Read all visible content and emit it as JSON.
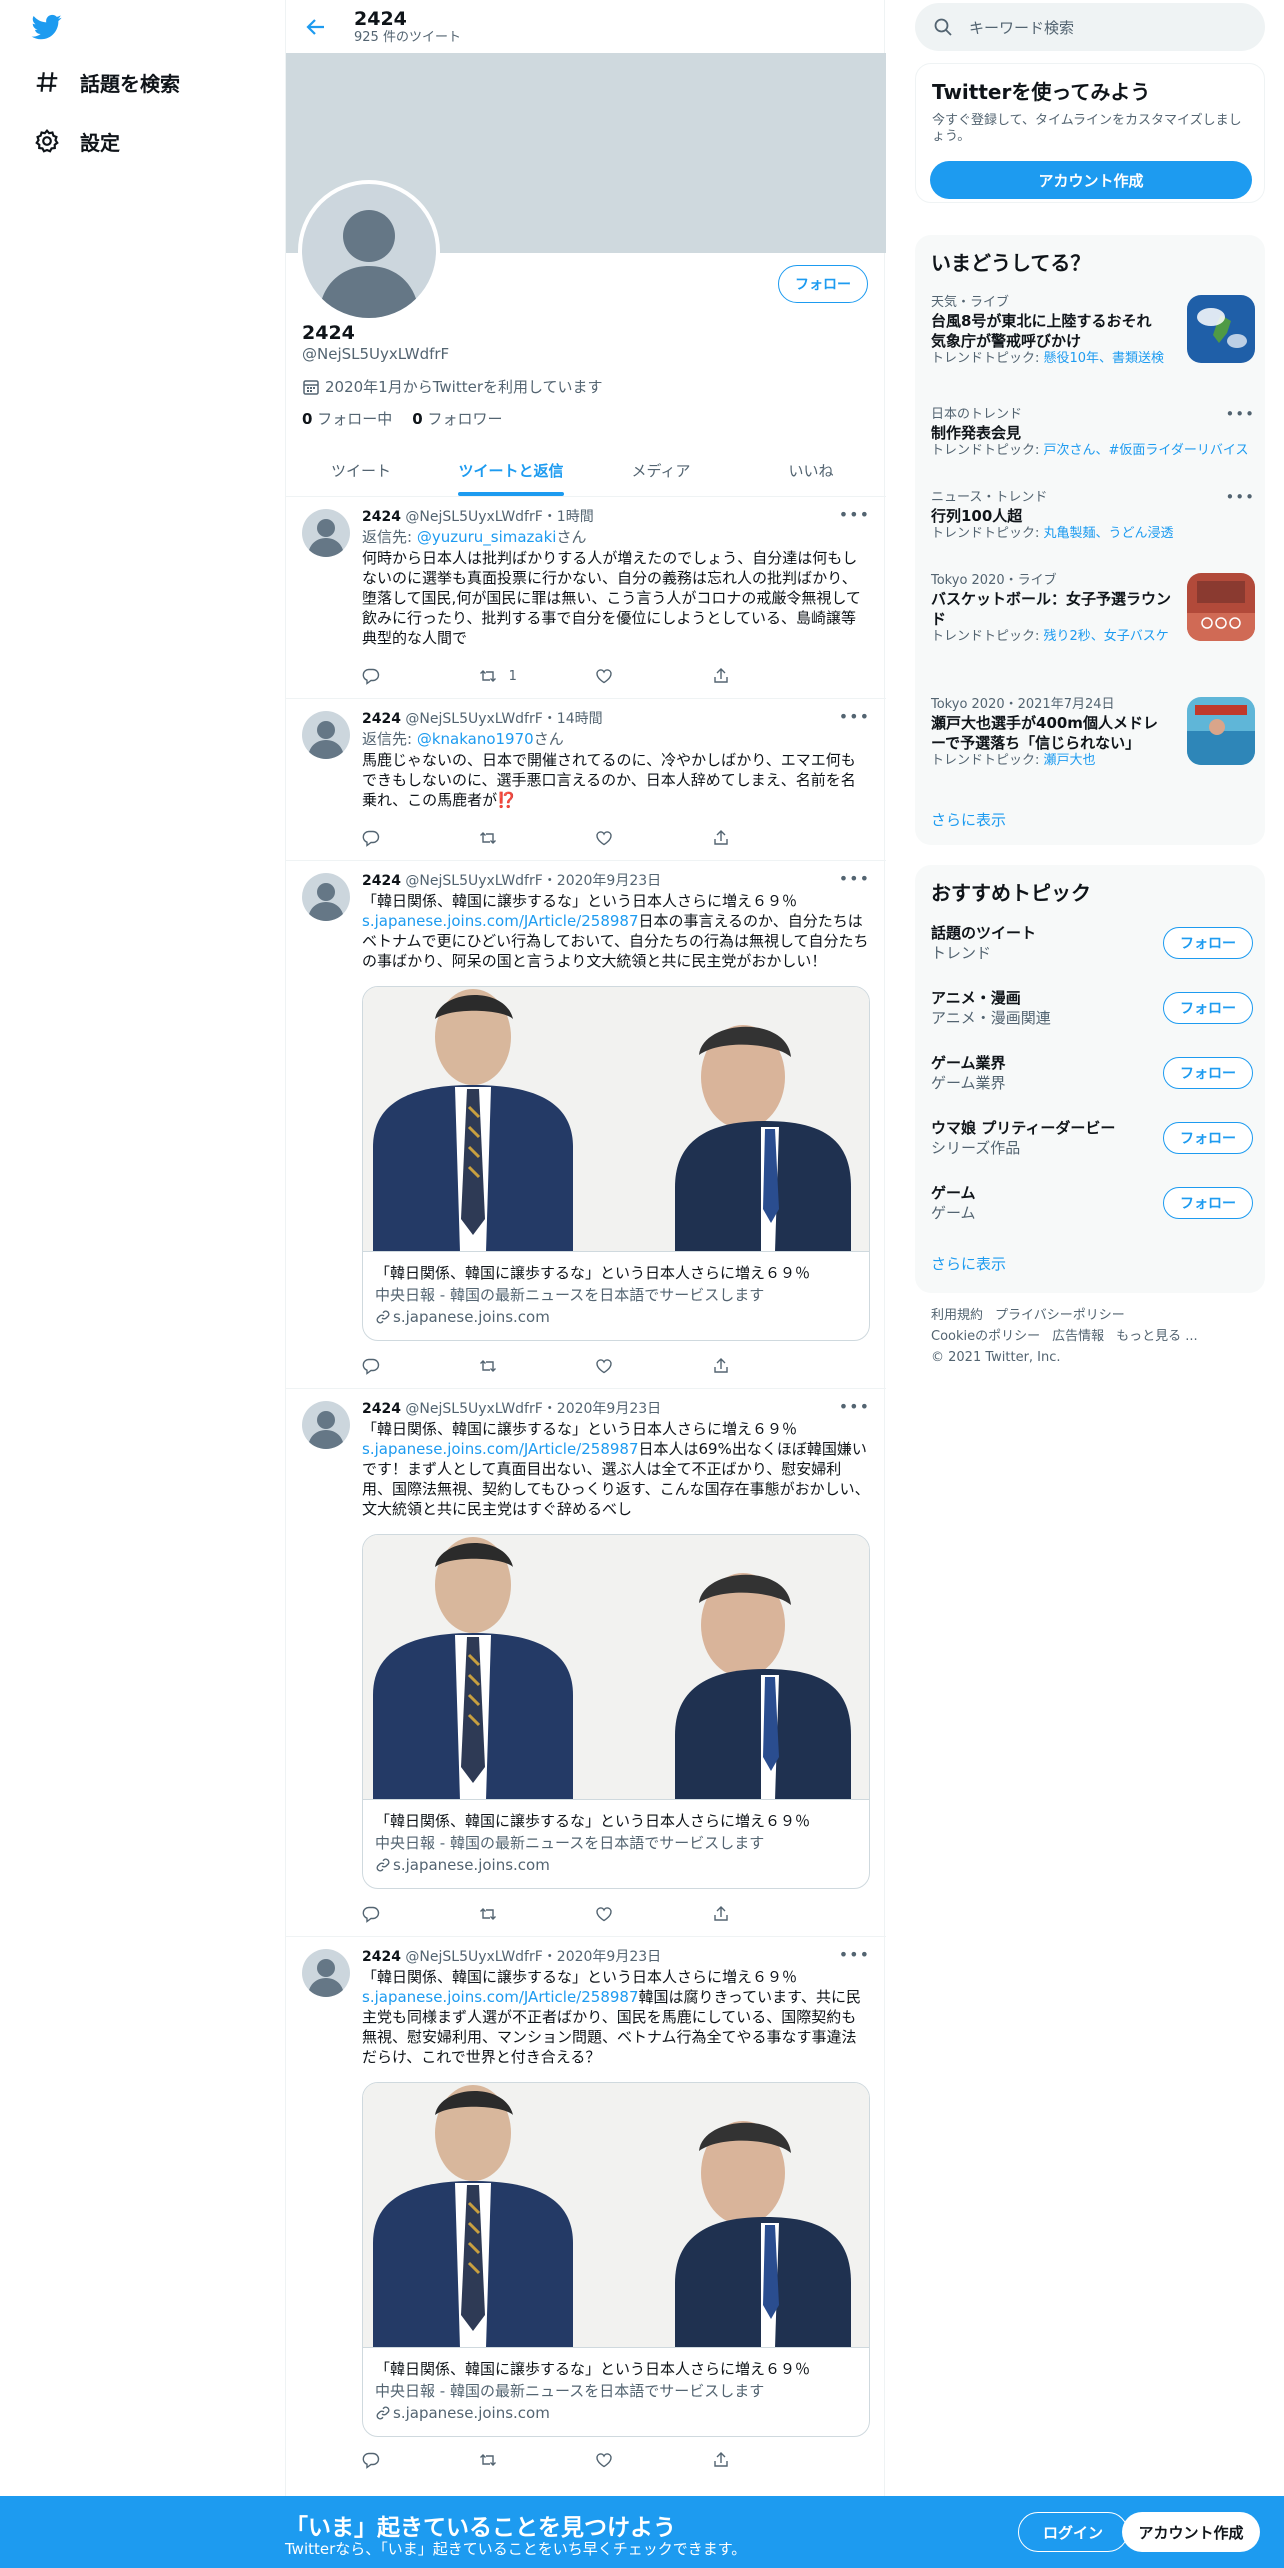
{
  "nav": {
    "explore": "話題を検索",
    "settings": "設定"
  },
  "profile": {
    "name": "2424",
    "tweet_count": "925 件のツイート",
    "handle": "@NejSL5UyxLWdfrF",
    "joined": "2020年1月からTwitterを利用しています",
    "following_count": "0",
    "following_label": "フォロー中",
    "followers_count": "0",
    "followers_label": "フォロワー",
    "follow_button": "フォロー"
  },
  "tabs": [
    "ツイート",
    "ツイートと返信",
    "メディア",
    "いいね"
  ],
  "tweets": [
    {
      "name": "2424",
      "handle": "@NejSL5UyxLWdfrF",
      "time": "1時間",
      "reply_prefix": "返信先: ",
      "reply_to": "@yuzuru_simazaki",
      "reply_suffix": "さん",
      "text": "何時から日本人は批判ばかりする人が増えたのでしょう、自分達は何もしないのに選挙も真面投票に行かない、自分の義務は忘れ人の批判ばかり、堕落して国民,何が国民に罪は無い、こう言う人がコロナの戒厳令無視して飲みに行ったり、批判する事で自分を優位にしようとしている、島崎譲等典型的な人間で",
      "retweets": "1"
    },
    {
      "name": "2424",
      "handle": "@NejSL5UyxLWdfrF",
      "time": "14時間",
      "reply_prefix": "返信先: ",
      "reply_to": "@knakano1970",
      "reply_suffix": "さん",
      "text": "馬鹿じゃないの、日本で開催されてるのに、冷やかしばかり、エマエ何もできもしないのに、選手悪口言えるのか、日本人辞めてしまえ、名前を名乗れ、この馬鹿者が⁉️"
    },
    {
      "name": "2424",
      "handle": "@NejSL5UyxLWdfrF",
      "time": "2020年9月23日",
      "line1": "「韓日関係、韓国に譲歩するな」という日本人さらに増え６９％",
      "link": "s.japanese.joins.com/JArticle/258987",
      "text": "日本の事言えるのか、自分たちはベトナムで更にひどい行為しておいて、自分たちの行為は無視して自分たちの事ばかり、阿呆の国と言うより文大統領と共に民主党がおかしい！",
      "card_title": "「韓日関係、韓国に譲歩するな」という日本人さらに増え６９％",
      "card_desc": "中央日報 - 韓国の最新ニュースを日本語でサービスします",
      "card_domain": "s.japanese.joins.com"
    },
    {
      "name": "2424",
      "handle": "@NejSL5UyxLWdfrF",
      "time": "2020年9月23日",
      "line1": "「韓日関係、韓国に譲歩するな」という日本人さらに増え６９％",
      "link": "s.japanese.joins.com/JArticle/258987",
      "text": "日本人は69%出なくほぼ韓国嫌いです！まず人として真面目出ない、選ぶ人は全て不正ばかり、慰安婦利用、国際法無視、契約してもひっくり返す、こんな国存在事態がおかしい、文大統領と共に民主党はすぐ辞めるべし",
      "card_title": "「韓日関係、韓国に譲歩するな」という日本人さらに増え６９％",
      "card_desc": "中央日報 - 韓国の最新ニュースを日本語でサービスします",
      "card_domain": "s.japanese.joins.com"
    },
    {
      "name": "2424",
      "handle": "@NejSL5UyxLWdfrF",
      "time": "2020年9月23日",
      "line1": "「韓日関係、韓国に譲歩するな」という日本人さらに増え６９％",
      "link": "s.japanese.joins.com/JArticle/258987",
      "text": "韓国は腐りきっています、共に民主党も同様まず人選が不正者ばかり、国民を馬鹿にしている、国際契約も無視、慰安婦利用、マンション問題、ベトナム行為全てやる事なす事違法だらけ、これで世界と付き合える？",
      "card_title": "「韓日関係、韓国に譲歩するな」という日本人さらに増え６９％",
      "card_desc": "中央日報 - 韓国の最新ニュースを日本語でサービスします",
      "card_domain": "s.japanese.joins.com"
    }
  ],
  "search": {
    "placeholder": "キーワード検索"
  },
  "signup": {
    "title": "Twitterを使ってみよう",
    "text": "今すぐ登録して、タイムラインをカスタマイズしましょう。",
    "button": "アカウント作成"
  },
  "trends": {
    "title": "いまどうしてる？",
    "items": [
      {
        "category": "天気・ライブ",
        "title": "台風8号が東北に上陸するおそれ 気象庁が警戒呼びかけ",
        "sub_prefix": "トレンドトピック: ",
        "sub_links": "懸役10年、書類送検"
      },
      {
        "category": "日本のトレンド",
        "title": "制作発表会見",
        "sub_prefix": "トレンドトピック: ",
        "sub_links": "戸次さん、#仮面ライダーリバイス"
      },
      {
        "category": "ニュース・トレンド",
        "title": "行列100人超",
        "sub_prefix": "トレンドトピック: ",
        "sub_links": "丸亀製麺、うどん浸透"
      },
      {
        "category": "Tokyo 2020・ライブ",
        "title": "バスケットボール：女子予選ラウンド",
        "sub_prefix": "トレンドトピック: ",
        "sub_links": "残り2秒、女子バスケ"
      },
      {
        "category": "Tokyo 2020・2021年7月24日",
        "title": "瀬戸大也選手が400m個人メドレーで予選落ち「信じられない」",
        "sub_prefix": "トレンドトピック: ",
        "sub_links": "瀬戸大也"
      }
    ],
    "more": "さらに表示"
  },
  "topics": {
    "title": "おすすめトピック",
    "items": [
      {
        "name": "話題のツイート",
        "sub": "トレンド",
        "button": "フォロー"
      },
      {
        "name": "アニメ・漫画",
        "sub": "アニメ・漫画関連",
        "button": "フォロー"
      },
      {
        "name": "ゲーム業界",
        "sub": "ゲーム業界",
        "button": "フォロー"
      },
      {
        "name": "ウマ娘 プリティーダービー",
        "sub": "シリーズ作品",
        "button": "フォロー"
      },
      {
        "name": "ゲーム",
        "sub": "ゲーム",
        "button": "フォロー"
      }
    ],
    "more": "さらに表示"
  },
  "footer": {
    "terms": "利用規約",
    "privacy": "プライバシーポリシー",
    "cookie": "Cookieのポリシー",
    "ads": "広告情報",
    "more": "もっと見る ...",
    "copyright": "© 2021 Twitter, Inc."
  },
  "bottom_bar": {
    "title": "「いま」起きていることを見つけよう",
    "subtitle": "Twitterなら、「いま」起きていることをいち早くチェックできます。",
    "login": "ログイン",
    "signup": "アカウント作成"
  },
  "colors": {
    "accent": "#1d9bf0",
    "text": "#0f1419",
    "secondary": "#536471",
    "banner": "#cfd9de"
  }
}
